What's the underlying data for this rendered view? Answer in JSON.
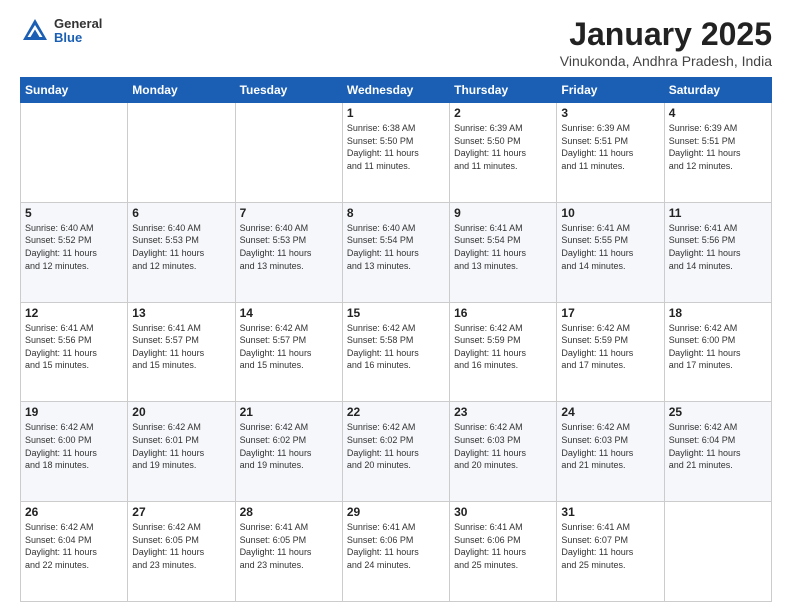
{
  "header": {
    "logo_general": "General",
    "logo_blue": "Blue",
    "month_title": "January 2025",
    "location": "Vinukonda, Andhra Pradesh, India"
  },
  "weekdays": [
    "Sunday",
    "Monday",
    "Tuesday",
    "Wednesday",
    "Thursday",
    "Friday",
    "Saturday"
  ],
  "weeks": [
    [
      {
        "day": "",
        "info": ""
      },
      {
        "day": "",
        "info": ""
      },
      {
        "day": "",
        "info": ""
      },
      {
        "day": "1",
        "info": "Sunrise: 6:38 AM\nSunset: 5:50 PM\nDaylight: 11 hours\nand 11 minutes."
      },
      {
        "day": "2",
        "info": "Sunrise: 6:39 AM\nSunset: 5:50 PM\nDaylight: 11 hours\nand 11 minutes."
      },
      {
        "day": "3",
        "info": "Sunrise: 6:39 AM\nSunset: 5:51 PM\nDaylight: 11 hours\nand 11 minutes."
      },
      {
        "day": "4",
        "info": "Sunrise: 6:39 AM\nSunset: 5:51 PM\nDaylight: 11 hours\nand 12 minutes."
      }
    ],
    [
      {
        "day": "5",
        "info": "Sunrise: 6:40 AM\nSunset: 5:52 PM\nDaylight: 11 hours\nand 12 minutes."
      },
      {
        "day": "6",
        "info": "Sunrise: 6:40 AM\nSunset: 5:53 PM\nDaylight: 11 hours\nand 12 minutes."
      },
      {
        "day": "7",
        "info": "Sunrise: 6:40 AM\nSunset: 5:53 PM\nDaylight: 11 hours\nand 13 minutes."
      },
      {
        "day": "8",
        "info": "Sunrise: 6:40 AM\nSunset: 5:54 PM\nDaylight: 11 hours\nand 13 minutes."
      },
      {
        "day": "9",
        "info": "Sunrise: 6:41 AM\nSunset: 5:54 PM\nDaylight: 11 hours\nand 13 minutes."
      },
      {
        "day": "10",
        "info": "Sunrise: 6:41 AM\nSunset: 5:55 PM\nDaylight: 11 hours\nand 14 minutes."
      },
      {
        "day": "11",
        "info": "Sunrise: 6:41 AM\nSunset: 5:56 PM\nDaylight: 11 hours\nand 14 minutes."
      }
    ],
    [
      {
        "day": "12",
        "info": "Sunrise: 6:41 AM\nSunset: 5:56 PM\nDaylight: 11 hours\nand 15 minutes."
      },
      {
        "day": "13",
        "info": "Sunrise: 6:41 AM\nSunset: 5:57 PM\nDaylight: 11 hours\nand 15 minutes."
      },
      {
        "day": "14",
        "info": "Sunrise: 6:42 AM\nSunset: 5:57 PM\nDaylight: 11 hours\nand 15 minutes."
      },
      {
        "day": "15",
        "info": "Sunrise: 6:42 AM\nSunset: 5:58 PM\nDaylight: 11 hours\nand 16 minutes."
      },
      {
        "day": "16",
        "info": "Sunrise: 6:42 AM\nSunset: 5:59 PM\nDaylight: 11 hours\nand 16 minutes."
      },
      {
        "day": "17",
        "info": "Sunrise: 6:42 AM\nSunset: 5:59 PM\nDaylight: 11 hours\nand 17 minutes."
      },
      {
        "day": "18",
        "info": "Sunrise: 6:42 AM\nSunset: 6:00 PM\nDaylight: 11 hours\nand 17 minutes."
      }
    ],
    [
      {
        "day": "19",
        "info": "Sunrise: 6:42 AM\nSunset: 6:00 PM\nDaylight: 11 hours\nand 18 minutes."
      },
      {
        "day": "20",
        "info": "Sunrise: 6:42 AM\nSunset: 6:01 PM\nDaylight: 11 hours\nand 19 minutes."
      },
      {
        "day": "21",
        "info": "Sunrise: 6:42 AM\nSunset: 6:02 PM\nDaylight: 11 hours\nand 19 minutes."
      },
      {
        "day": "22",
        "info": "Sunrise: 6:42 AM\nSunset: 6:02 PM\nDaylight: 11 hours\nand 20 minutes."
      },
      {
        "day": "23",
        "info": "Sunrise: 6:42 AM\nSunset: 6:03 PM\nDaylight: 11 hours\nand 20 minutes."
      },
      {
        "day": "24",
        "info": "Sunrise: 6:42 AM\nSunset: 6:03 PM\nDaylight: 11 hours\nand 21 minutes."
      },
      {
        "day": "25",
        "info": "Sunrise: 6:42 AM\nSunset: 6:04 PM\nDaylight: 11 hours\nand 21 minutes."
      }
    ],
    [
      {
        "day": "26",
        "info": "Sunrise: 6:42 AM\nSunset: 6:04 PM\nDaylight: 11 hours\nand 22 minutes."
      },
      {
        "day": "27",
        "info": "Sunrise: 6:42 AM\nSunset: 6:05 PM\nDaylight: 11 hours\nand 23 minutes."
      },
      {
        "day": "28",
        "info": "Sunrise: 6:41 AM\nSunset: 6:05 PM\nDaylight: 11 hours\nand 23 minutes."
      },
      {
        "day": "29",
        "info": "Sunrise: 6:41 AM\nSunset: 6:06 PM\nDaylight: 11 hours\nand 24 minutes."
      },
      {
        "day": "30",
        "info": "Sunrise: 6:41 AM\nSunset: 6:06 PM\nDaylight: 11 hours\nand 25 minutes."
      },
      {
        "day": "31",
        "info": "Sunrise: 6:41 AM\nSunset: 6:07 PM\nDaylight: 11 hours\nand 25 minutes."
      },
      {
        "day": "",
        "info": ""
      }
    ]
  ]
}
